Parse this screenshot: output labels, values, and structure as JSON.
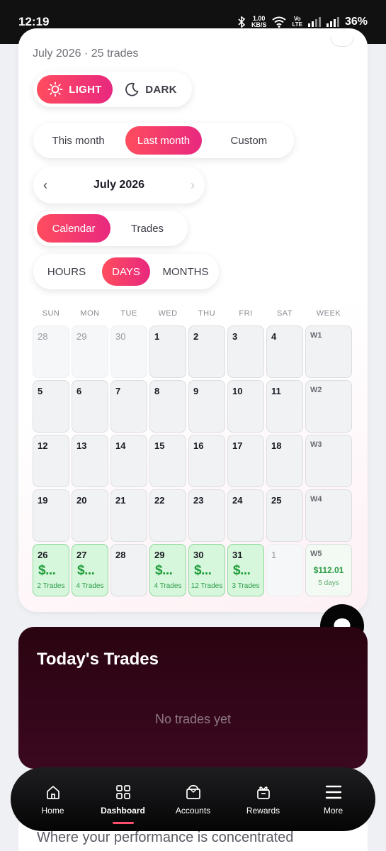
{
  "status": {
    "time": "12:19",
    "speed_value": "1.00",
    "speed_unit": "KB/S",
    "lte_top": "Vo",
    "lte_bottom": "LTE",
    "battery": "36%"
  },
  "header": {
    "subtitle": "July 2026 · 25 trades"
  },
  "theme": {
    "light_label": "LIGHT",
    "dark_label": "DARK",
    "selected": "LIGHT"
  },
  "range": {
    "options": [
      "This month",
      "Last month",
      "Custom"
    ],
    "selected": "Last month"
  },
  "month_nav": {
    "label": "July 2026",
    "prev_icon": "chevron-left-icon",
    "next_icon": "chevron-right-icon"
  },
  "view": {
    "options": [
      "Calendar",
      "Trades"
    ],
    "selected": "Calendar"
  },
  "granularity": {
    "options": [
      "HOURS",
      "DAYS",
      "MONTHS"
    ],
    "selected": "DAYS"
  },
  "calendar": {
    "weekdays": [
      "SUN",
      "MON",
      "TUE",
      "WED",
      "THU",
      "FRI",
      "SAT",
      "WEEK"
    ],
    "weeks": [
      {
        "label": "W1",
        "days": [
          {
            "day": "28",
            "other": true
          },
          {
            "day": "29",
            "other": true
          },
          {
            "day": "30",
            "other": true
          },
          {
            "day": "1"
          },
          {
            "day": "2"
          },
          {
            "day": "3"
          },
          {
            "day": "4"
          }
        ]
      },
      {
        "label": "W2",
        "days": [
          {
            "day": "5"
          },
          {
            "day": "6"
          },
          {
            "day": "7"
          },
          {
            "day": "8"
          },
          {
            "day": "9"
          },
          {
            "day": "10"
          },
          {
            "day": "11"
          }
        ]
      },
      {
        "label": "W3",
        "days": [
          {
            "day": "12"
          },
          {
            "day": "13"
          },
          {
            "day": "14"
          },
          {
            "day": "15"
          },
          {
            "day": "16"
          },
          {
            "day": "17"
          },
          {
            "day": "18"
          }
        ]
      },
      {
        "label": "W4",
        "days": [
          {
            "day": "19"
          },
          {
            "day": "20"
          },
          {
            "day": "21"
          },
          {
            "day": "22"
          },
          {
            "day": "23"
          },
          {
            "day": "24"
          },
          {
            "day": "25"
          }
        ]
      },
      {
        "label": "W5",
        "total": "$112.01",
        "days_count": "5 days",
        "days": [
          {
            "day": "26",
            "amount": "$...",
            "trades": "2 Trades"
          },
          {
            "day": "27",
            "amount": "$...",
            "trades": "4 Trades"
          },
          {
            "day": "28"
          },
          {
            "day": "29",
            "amount": "$...",
            "trades": "4 Trades"
          },
          {
            "day": "30",
            "amount": "$...",
            "trades": "12 Trades"
          },
          {
            "day": "31",
            "amount": "$...",
            "trades": "3 Trades"
          },
          {
            "day": "1",
            "other": true
          }
        ]
      }
    ]
  },
  "today": {
    "title": "Today's Trades",
    "empty": "No trades yet"
  },
  "below": {
    "text": "Where your performance is concentrated"
  },
  "nav": {
    "items": [
      {
        "label": "Home",
        "icon": "home-icon"
      },
      {
        "label": "Dashboard",
        "icon": "grid-icon",
        "active": true
      },
      {
        "label": "Accounts",
        "icon": "wallet-icon"
      },
      {
        "label": "Rewards",
        "icon": "gift-icon"
      },
      {
        "label": "More",
        "icon": "menu-icon"
      }
    ]
  },
  "colors": {
    "accent_start": "#ff4d5e",
    "accent_end": "#e8287f",
    "profit": "#1e9c3a",
    "win_bg": "#d6f7dc",
    "trades_bg": "#2a0410"
  }
}
